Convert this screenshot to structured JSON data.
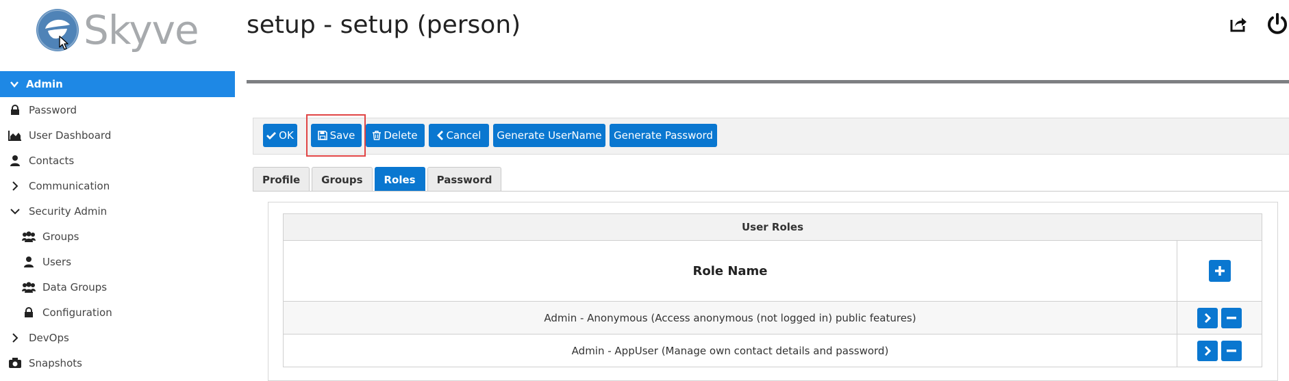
{
  "brand": {
    "name": "Skyve",
    "color": "#4f83b7",
    "text_color": "#a7aaad"
  },
  "header": {
    "title": "setup - setup (person)",
    "icons": [
      "share-icon",
      "power-icon"
    ]
  },
  "sidebar": {
    "module": "Admin",
    "items": [
      {
        "label": "Password",
        "icon": "lock-icon"
      },
      {
        "label": "User Dashboard",
        "icon": "area-chart-icon"
      },
      {
        "label": "Contacts",
        "icon": "user-icon"
      },
      {
        "label": "Communication",
        "icon": "chevron-right-icon"
      },
      {
        "label": "Security Admin",
        "icon": "chevron-down-icon"
      },
      {
        "label": "Groups",
        "icon": "users-icon"
      },
      {
        "label": "Users",
        "icon": "user-icon"
      },
      {
        "label": "Data Groups",
        "icon": "users-icon"
      },
      {
        "label": "Configuration",
        "icon": "lock-icon"
      },
      {
        "label": "DevOps",
        "icon": "chevron-right-icon"
      },
      {
        "label": "Snapshots",
        "icon": "camera-icon"
      }
    ]
  },
  "toolbar": {
    "ok": "OK",
    "save": "Save",
    "delete": "Delete",
    "cancel": "Cancel",
    "generate_username": "Generate UserName",
    "generate_password": "Generate Password"
  },
  "tabs": [
    {
      "label": "Profile",
      "active": false
    },
    {
      "label": "Groups",
      "active": false
    },
    {
      "label": "Roles",
      "active": true
    },
    {
      "label": "Password",
      "active": false
    }
  ],
  "grid": {
    "title": "User Roles",
    "column": "Role Name",
    "rows": [
      "Admin - Anonymous (Access anonymous (not logged in) public features)",
      "Admin - AppUser (Manage own contact details and password)"
    ]
  },
  "colors": {
    "accent": "#1e88e5",
    "button": "#0a77d0",
    "highlight": "#e04444"
  }
}
